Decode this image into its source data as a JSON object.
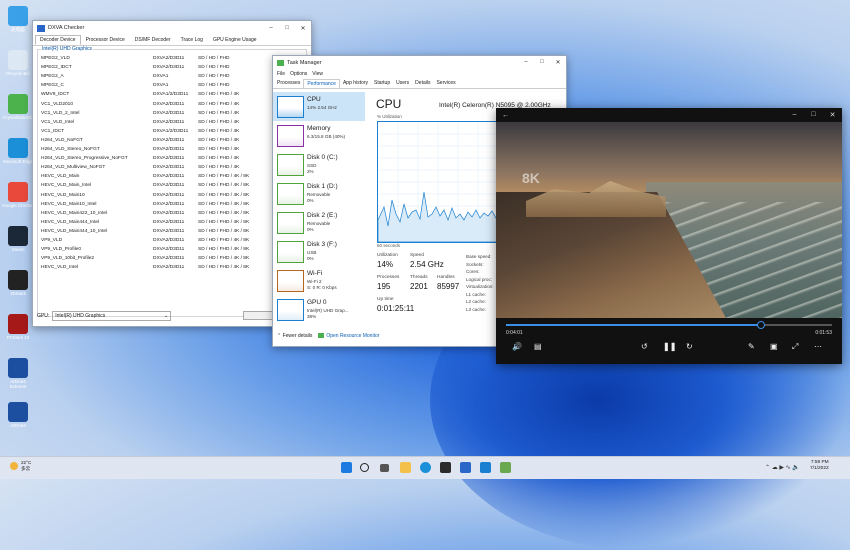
{
  "desktop_icons": [
    {
      "label": "此电脑",
      "color": "#3aa0e8"
    },
    {
      "label": "Recycle Bin",
      "color": "#dce8f3"
    },
    {
      "label": "CrystalDiskInfo",
      "color": "#4cb34c"
    },
    {
      "label": "Microsoft Edge",
      "color": "#1b8fd8"
    },
    {
      "label": "Google Chrome",
      "color": "#e9493b"
    },
    {
      "label": "Steam",
      "color": "#1b2838"
    },
    {
      "label": "3DMark",
      "color": "#222222"
    },
    {
      "label": "PCMark 10",
      "color": "#a51919"
    },
    {
      "label": "AIDA64 Extreme",
      "color": "#1c4fa0"
    },
    {
      "label": "AIDA64",
      "color": "#1c4fa0"
    }
  ],
  "dxva": {
    "title": "DXVA Checker",
    "tabs": [
      "Decoder Device",
      "Processor Device",
      "DS/MF Decoder",
      "Trace Log",
      "GPU Engine Usage"
    ],
    "group_label": "Intel(R) UHD Graphics",
    "rows": [
      [
        "MPEG2_VLD",
        "DXVA2/D3D11",
        "SD / HD / FHD"
      ],
      [
        "MPEG2_IDCT",
        "DXVA2/D3D11",
        "SD / HD / FHD"
      ],
      [
        "MPEG2_A",
        "DXVA1",
        "SD / HD / FHD"
      ],
      [
        "MPEG2_C",
        "DXVA1",
        "SD / HD / FHD"
      ],
      [
        "WMV9_IDCT",
        "DXVA1/2/D3D11",
        "SD / HD / FHD / 4K"
      ],
      [
        "VC1_VLD2010",
        "DXVA2/D3D11",
        "SD / HD / FHD / 4K"
      ],
      [
        "VC1_VLD_2_Intel",
        "DXVA2/D3D11",
        "SD / HD / FHD / 4K"
      ],
      [
        "VC1_VLD_Intel",
        "DXVA2/D3D11",
        "SD / HD / FHD / 4K"
      ],
      [
        "VC1_IDCT",
        "DXVA1/2/D3D11",
        "SD / HD / FHD / 4K"
      ],
      [
        "H264_VLD_NoFGT",
        "DXVA2/D3D11",
        "SD / HD / FHD / 4K"
      ],
      [
        "H264_VLD_Stereo_NoFGT",
        "DXVA2/D3D11",
        "SD / HD / FHD / 4K"
      ],
      [
        "H264_VLD_Stereo_Progressive_NoFGT",
        "DXVA2/D3D11",
        "SD / HD / FHD / 4K"
      ],
      [
        "H264_VLD_Multiview_NoFGT",
        "DXVA2/D3D11",
        "SD / HD / FHD / 4K"
      ],
      [
        "HEVC_VLD_Main",
        "DXVA2/D3D11",
        "SD / HD / FHD / 4K / 8K"
      ],
      [
        "HEVC_VLD_Main_Intel",
        "DXVA2/D3D11",
        "SD / HD / FHD / 4K / 8K"
      ],
      [
        "HEVC_VLD_Main10",
        "DXVA2/D3D11",
        "SD / HD / FHD / 4K / 8K"
      ],
      [
        "HEVC_VLD_Main10_Intel",
        "DXVA2/D3D11",
        "SD / HD / FHD / 4K / 8K"
      ],
      [
        "HEVC_VLD_Main422_10_Intel",
        "DXVA2/D3D11",
        "SD / HD / FHD / 4K / 8K"
      ],
      [
        "HEVC_VLD_Main444_Intel",
        "DXVA2/D3D11",
        "SD / HD / FHD / 4K / 8K"
      ],
      [
        "HEVC_VLD_Main444_10_Intel",
        "DXVA2/D3D11",
        "SD / HD / FHD / 4K / 8K"
      ],
      [
        "VP9_VLD",
        "DXVA2/D3D11",
        "SD / HD / FHD / 4K / 8K"
      ],
      [
        "VP9_VLD_Profile0",
        "DXVA2/D3D11",
        "SD / HD / FHD / 4K / 8K"
      ],
      [
        "VP9_VLD_10bit_Profile2",
        "DXVA2/D3D11",
        "SD / HD / FHD / 4K / 8K"
      ],
      [
        "HEVC_VLD_Intel",
        "DXVA2/D3D11",
        "SD / HD / FHD / 4K / 8K"
      ]
    ],
    "gpu_label": "GPU:",
    "gpu_value": "Intel(R) UHD Graphics",
    "close_label": "Close"
  },
  "taskmgr": {
    "title": "Task Manager",
    "menus": [
      "File",
      "Options",
      "View"
    ],
    "tabs": [
      "Processes",
      "Performance",
      "App history",
      "Startup",
      "Users",
      "Details",
      "Services"
    ],
    "side": [
      {
        "name": "CPU",
        "s1": "14% 2.54 GHz",
        "s2": "",
        "color": "#1a7fd0"
      },
      {
        "name": "Memory",
        "s1": "6.3/15.8 GB (40%)",
        "s2": "",
        "color": "#8b2fa7"
      },
      {
        "name": "Disk 0 (C:)",
        "s1": "SSD",
        "s2": "2%",
        "color": "#4fa33a"
      },
      {
        "name": "Disk 1 (D:)",
        "s1": "Removable",
        "s2": "0%",
        "color": "#4fa33a"
      },
      {
        "name": "Disk 2 (E:)",
        "s1": "Removable",
        "s2": "0%",
        "color": "#4fa33a"
      },
      {
        "name": "Disk 3 (F:)",
        "s1": "USB",
        "s2": "0%",
        "color": "#4fa33a"
      },
      {
        "name": "Wi-Fi",
        "s1": "Wi-Fi 2",
        "s2": "S: 0 R: 0 Kbps",
        "color": "#b5651d"
      },
      {
        "name": "GPU 0",
        "s1": "Intel(R) UHD Grap...",
        "s2": "38%",
        "color": "#1a7fd0"
      }
    ],
    "heading": "CPU",
    "cpu_model": "Intel(R) Celeron(R) N5095 @ 2.00GHz",
    "graph_label": "% Utilization",
    "graph_time": "60 seconds",
    "stats": {
      "utilization_label": "Utilization",
      "utilization": "14%",
      "speed_label": "Speed",
      "speed": "2.54 GHz",
      "processes_label": "Processes",
      "processes": "195",
      "threads_label": "Threads",
      "threads": "2201",
      "handles_label": "Handles",
      "handles": "85997",
      "uptime_label": "Up time",
      "uptime": "0:01:25:11"
    },
    "right_labels": [
      "Base speed:",
      "Sockets:",
      "Cores:",
      "Logical proc:",
      "Virtualization:",
      "L1 cache:",
      "L2 cache:",
      "L3 cache:"
    ],
    "fewer_details": "Fewer details",
    "open_monitor": "Open Resource Monitor"
  },
  "player": {
    "time_elapsed": "0:04:01",
    "time_remaining": "0:01:53",
    "progress": 0.78,
    "watermark": "8K"
  },
  "taskbar": {
    "weather_temp": "22°C",
    "weather_desc": "多云",
    "time": "7:59 PM",
    "date": "7/1/2022"
  }
}
